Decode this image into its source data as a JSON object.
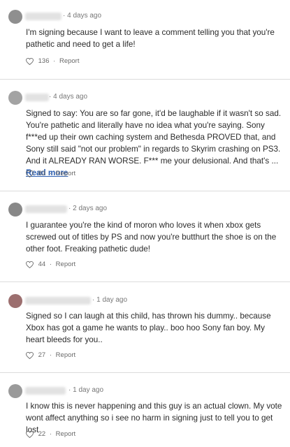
{
  "comments": [
    {
      "time": "4 days ago",
      "text": "I'm signing because I want to leave a comment telling you that you're pathetic and need to get a life!",
      "likes": "136",
      "report": "Report"
    },
    {
      "time": "4 days ago",
      "text": "Signed to say: You are so far gone, it'd be laughable if it wasn't so sad. You're pathetic and literally have no idea what you're saying. Sony f***ed up their own caching system and Bethesda PROVED that, and Sony still said \"not our problem\" in regards to Skyrim crashing on PS3. And it ALREADY RAN WORSE. F*** me your delusional. And that's ...",
      "read_more": "Read more",
      "likes": "83",
      "report": "Report"
    },
    {
      "time": "2 days ago",
      "text": "I guarantee you're the kind of moron who loves it when xbox gets screwed out of titles by PS and now you're butthurt the shoe is on the other foot. Freaking pathetic dude!",
      "likes": "44",
      "report": "Report"
    },
    {
      "time": "1 day ago",
      "text": "Signed so I can laugh at this child, has thrown his dummy.. because Xbox has got a game he wants to play.. boo hoo Sony fan boy. My heart bleeds for you..",
      "likes": "27",
      "report": "Report"
    },
    {
      "time": "1 day ago",
      "text": "I know this is never happening and this guy is an actual clown. My vote wont affect anything so i see no harm in signing just to tell you to get lost",
      "likes": "22",
      "report": "Report"
    }
  ],
  "icons": {
    "avatar": "avatar",
    "like": "heart-icon"
  },
  "colors": {
    "link": "#2a5db0",
    "divider": "#dcdcdc",
    "meta": "#777777"
  }
}
